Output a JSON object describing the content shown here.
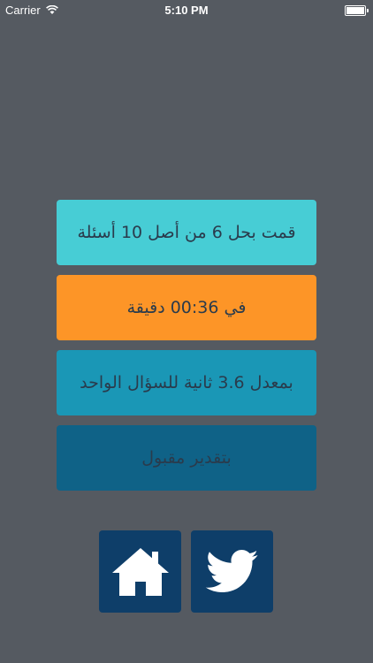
{
  "status_bar": {
    "carrier": "Carrier",
    "time": "5:10 PM"
  },
  "results": [
    {
      "text": "قمت بحل 6 من أصل 10 أسئلة",
      "color": "#47cdd5"
    },
    {
      "text": "في 00:36 دقيقة",
      "color": "#fd9527"
    },
    {
      "text": "بمعدل  3.6 ثانية للسؤال الواحد",
      "color": "#1a97b6"
    },
    {
      "text": "بتقدير مقبول",
      "color": "#0f6287"
    }
  ],
  "actions": {
    "home_icon": "home-icon",
    "twitter_icon": "twitter-bird-icon",
    "button_color": "#0e3e69"
  },
  "colors": {
    "background": "#555a61",
    "card_text": "#2a3b4c"
  }
}
